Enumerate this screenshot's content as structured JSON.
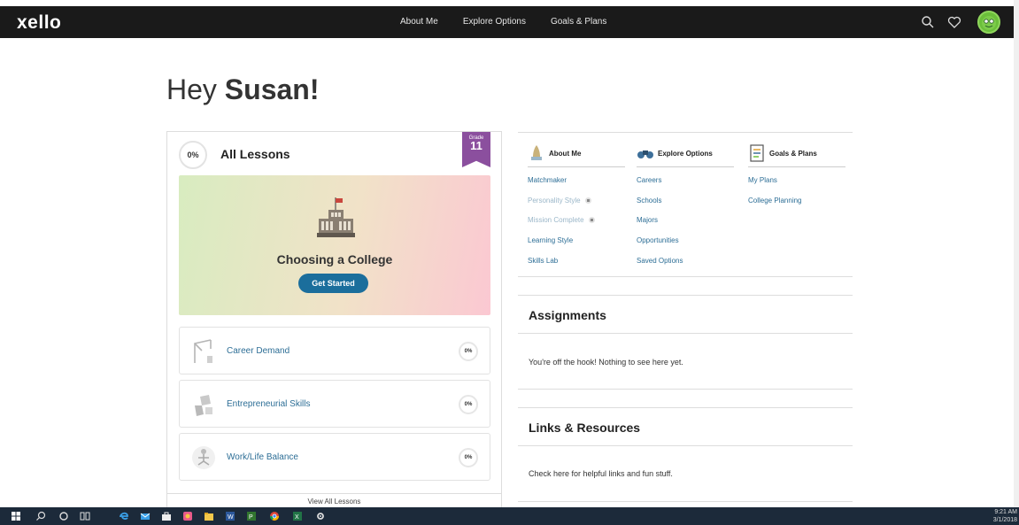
{
  "nav": {
    "logo": "xello",
    "links": [
      "About Me",
      "Explore Options",
      "Goals & Plans"
    ],
    "icons": [
      "search-icon",
      "heart-icon",
      "avatar"
    ]
  },
  "greeting": {
    "prefix": "Hey ",
    "name": "Susan!"
  },
  "lessons": {
    "progress": "0%",
    "title": "All Lessons",
    "grade_label": "Grade",
    "grade_value": "11",
    "featured": {
      "title": "Choosing a College",
      "button": "Get Started"
    },
    "items": [
      {
        "label": "Career Demand",
        "progress": "0%"
      },
      {
        "label": "Entrepreneurial Skills",
        "progress": "0%"
      },
      {
        "label": "Work/Life Balance",
        "progress": "0%"
      }
    ],
    "view_all": "View All Lessons"
  },
  "quick_links": {
    "about_me": {
      "title": "About Me",
      "items": [
        "Matchmaker",
        "Personality Style",
        "Mission Complete",
        "Learning Style",
        "Skills Lab"
      ]
    },
    "explore": {
      "title": "Explore Options",
      "items": [
        "Careers",
        "Schools",
        "Majors",
        "Opportunities",
        "Saved Options"
      ]
    },
    "goals": {
      "title": "Goals & Plans",
      "items": [
        "My Plans",
        "College Planning"
      ]
    }
  },
  "assignments": {
    "title": "Assignments",
    "text": "You're off the hook! Nothing to see here yet."
  },
  "links": {
    "title": "Links & Resources",
    "text": "Check here for helpful links and fun stuff."
  },
  "taskbar": {
    "time": "9:21 AM",
    "date": "3/1/2018"
  },
  "colors": {
    "nav_bg": "#1a1a1a",
    "link": "#2d6e96",
    "button": "#1b6e9c",
    "grade": "#8b4f9e"
  }
}
